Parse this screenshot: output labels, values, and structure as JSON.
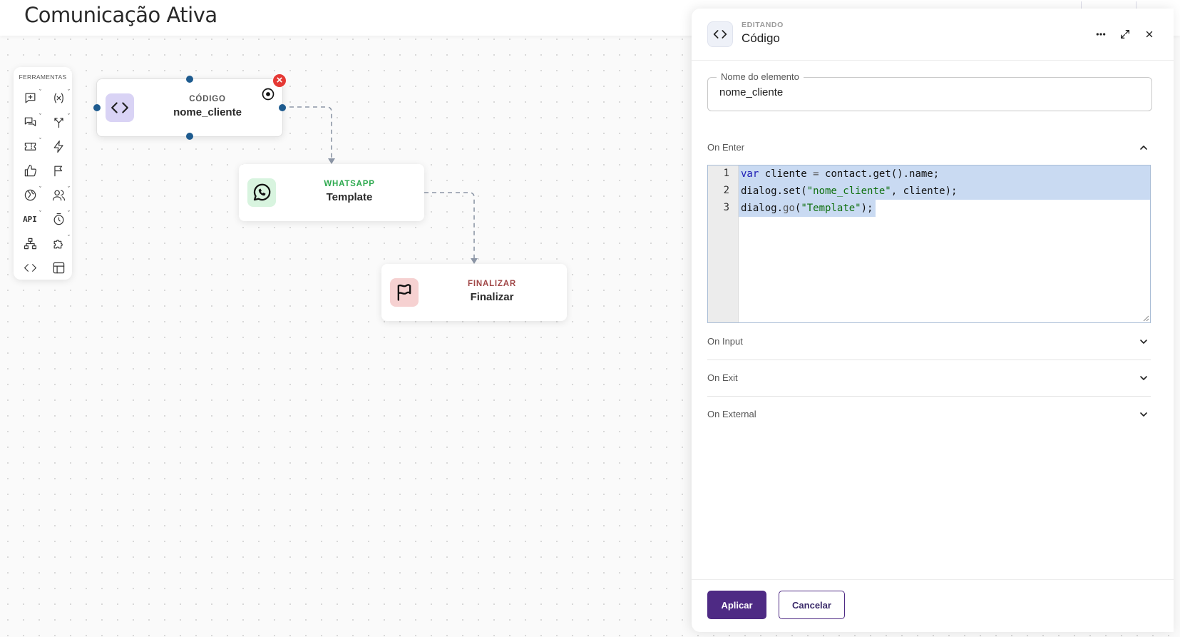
{
  "page": {
    "title": "Comunicação Ativa"
  },
  "tools": {
    "title": "FERRAMENTAS",
    "items": [
      {
        "name": "add-message-icon",
        "caret": "ˇ"
      },
      {
        "name": "variable-icon",
        "caret": "ˇ"
      },
      {
        "name": "chat-bubbles-icon",
        "caret": "ˇ"
      },
      {
        "name": "split-arrows-icon",
        "caret": "ˇ"
      },
      {
        "name": "ticket-icon",
        "caret": "ˇ"
      },
      {
        "name": "lightning-icon",
        "caret": ""
      },
      {
        "name": "thumbs-up-icon",
        "caret": ""
      },
      {
        "name": "flag-icon",
        "caret": ""
      },
      {
        "name": "globe-icon",
        "caret": "ˇ"
      },
      {
        "name": "users-icon",
        "caret": "ˇ"
      },
      {
        "name": "api-icon",
        "label": "API",
        "caret": "ˇ"
      },
      {
        "name": "timer-icon",
        "caret": "ˇ"
      },
      {
        "name": "hierarchy-icon",
        "caret": ""
      },
      {
        "name": "puzzle-icon",
        "caret": "ˇ"
      },
      {
        "name": "code-icon",
        "caret": ""
      },
      {
        "name": "table-icon",
        "caret": ""
      }
    ]
  },
  "nodes": {
    "code": {
      "type": "CÓDIGO",
      "name": "nome_cliente",
      "icon": "code-icon",
      "color": "#555555",
      "icon_bg": "#d9d3f5"
    },
    "whatsapp": {
      "type": "WHATSAPP",
      "name": "Template",
      "icon": "whatsapp-icon",
      "color": "#2eaa4f",
      "icon_bg": "#d8f4df"
    },
    "finalizar": {
      "type": "FINALIZAR",
      "name": "Finalizar",
      "icon": "flag-icon",
      "color": "#a14848",
      "icon_bg": "#f6d1d1"
    }
  },
  "panel": {
    "editing_label": "EDITANDO",
    "title": "Código",
    "field": {
      "legend": "Nome do elemento",
      "value": "nome_cliente"
    },
    "sections": {
      "on_enter": "On Enter",
      "on_input": "On Input",
      "on_exit": "On Exit",
      "on_external": "On External"
    },
    "code": {
      "line_numbers": [
        "1",
        "2",
        "3"
      ],
      "line1": {
        "kw": "var",
        "rest": " cliente ",
        "op": "=",
        "tail": " contact.get().name;"
      },
      "line2": {
        "head": "dialog.set(",
        "str": "\"nome_cliente\"",
        "tail": ", cliente);"
      },
      "line3": {
        "head": "dialog.",
        "fn": "go",
        "paren": "(",
        "str": "\"Template\"",
        "tail": ");"
      }
    },
    "buttons": {
      "apply": "Aplicar",
      "cancel": "Cancelar"
    }
  },
  "colors": {
    "accent": "#4e2a84",
    "port": "#1e5b8f",
    "delete": "#e53935",
    "selection": "#c9daf2"
  }
}
